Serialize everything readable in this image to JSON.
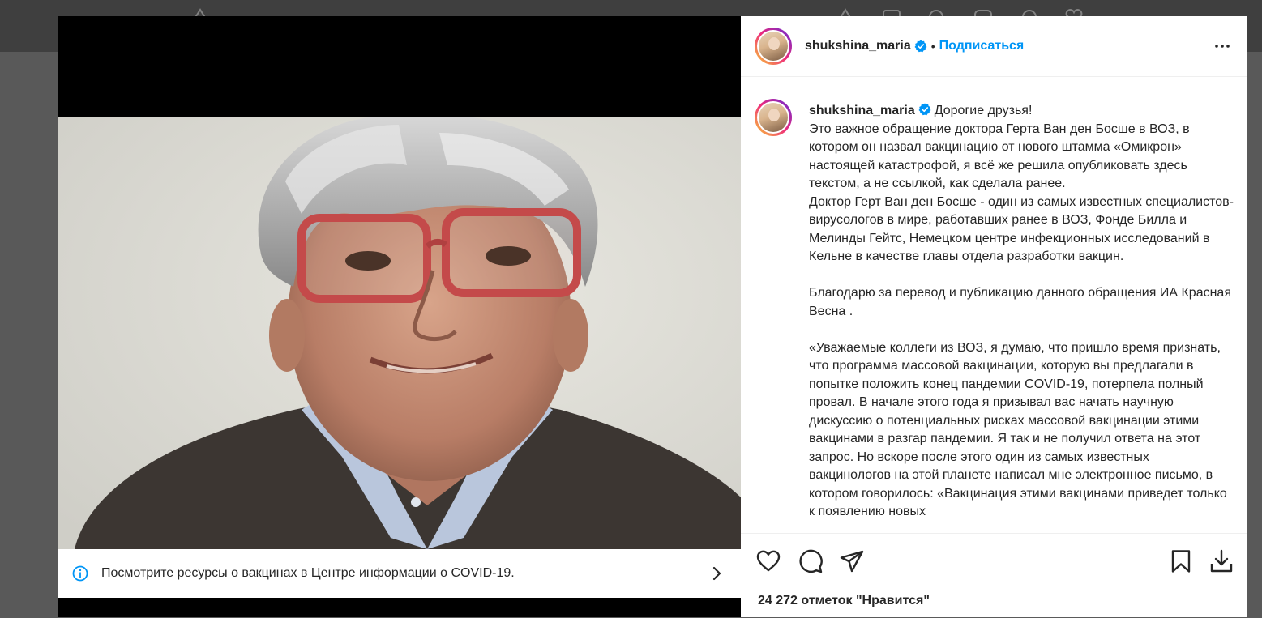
{
  "media": {
    "covid_banner": {
      "text": "Посмотрите ресурсы о вакцинах в Центре информации о COVID-19."
    }
  },
  "post": {
    "header": {
      "username": "shukshina_maria",
      "separator": "•",
      "follow_label": "Подписаться"
    },
    "caption": {
      "username": "shukshina_maria",
      "text": "Дорогие друзья!\nЭто важное обращение доктора Герта Ван ден Босше в ВОЗ, в котором он назвал вакцинацию от нового штамма «Омикрон» настоящей катастрофой, я всё же решила опубликовать здесь текстом, а не ссылкой, как сделала ранее.\nДоктор Герт Ван ден Босше - один из самых известных специалистов-вирусологов в мире, работавших ранее в ВОЗ, Фонде Билла и Мелинды Гейтс, Немецком центре инфекционных исследований в Кельне в качестве главы отдела разработки вакцин.\n\nБлагодарю за перевод и публикацию данного обращения ИА Красная Весна .\n\n«Уважаемые коллеги из ВОЗ, я думаю, что пришло время признать, что программа массовой вакцинации, которую вы предлагали в попытке положить конец пандемии COVID-19, потерпела полный провал. В начале этого года я призывал вас начать научную дискуссию о потенциальных рисках массовой вакцинации этими вакцинами в разгар пандемии. Я так и не получил ответа на этот запрос. Но вскоре после этого один из самых известных вакцинологов на этой планете написал мне электронное письмо, в котором говорилось: «Вакцинация этими вакцинами приведет только к появлению новых"
    },
    "likes_text": "24 272 отметок \"Нравится\""
  },
  "icons": {
    "info": "info-circle-icon",
    "chevron": "chevron-right-icon",
    "verified": "verified-badge-icon",
    "more": "more-options-icon",
    "like": "heart-icon",
    "comment": "comment-icon",
    "share": "share-icon",
    "save": "bookmark-icon",
    "download": "download-icon"
  },
  "colors": {
    "accent": "#0095f6",
    "text": "#262626",
    "divider": "#efefef"
  }
}
